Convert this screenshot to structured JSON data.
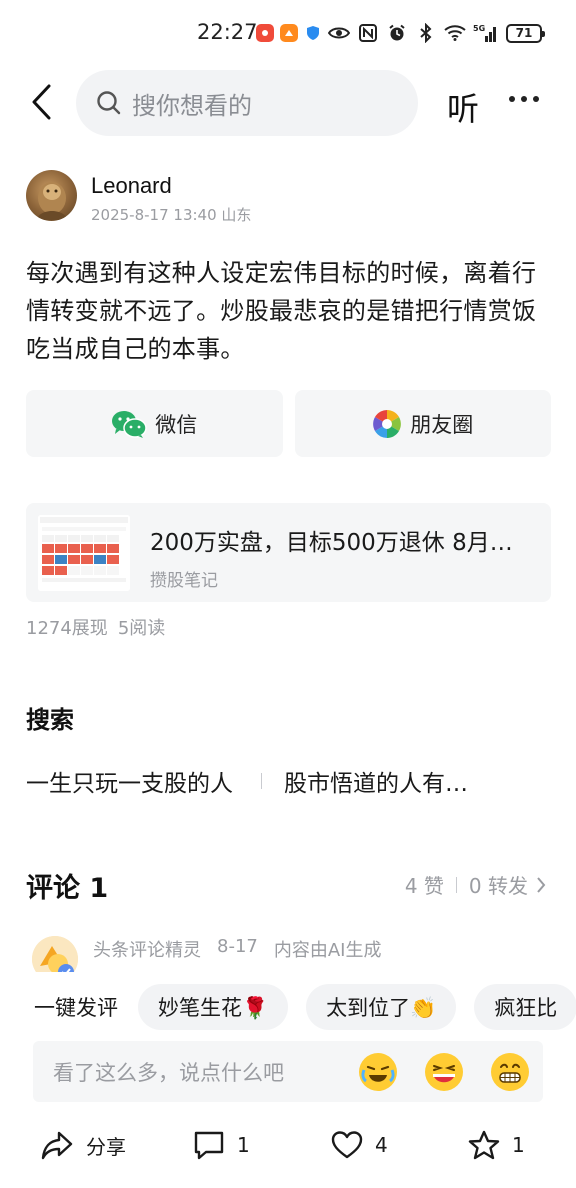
{
  "status_bar": {
    "time": "22:27",
    "battery": "71",
    "network": "5G",
    "nfc_label": "N"
  },
  "header": {
    "search_placeholder": "搜你想看的",
    "listen_label": "听"
  },
  "author": {
    "name": "Leonard",
    "datetime": "2025-8-17 13:40",
    "location": "山东"
  },
  "post": {
    "text": "每次遇到有这种人设定宏伟目标的时候，离着行情转变就不远了。炒股最悲哀的是错把行情赏饭吃当成自己的本事。"
  },
  "share": {
    "wechat_label": "微信",
    "moments_label": "朋友圈"
  },
  "linked_card": {
    "title": "200万实盘，目标500万退休 8月…",
    "source": "攒股笔记"
  },
  "stats": {
    "impressions": "1274展现",
    "reads": "5阅读"
  },
  "search_section": {
    "title": "搜索",
    "suggestions": [
      "一生只玩一支股的人",
      "股市悟道的人有…"
    ]
  },
  "comments": {
    "title": "评论 1",
    "likes": "4 赞",
    "reposts": "0 转发",
    "ai_comment": {
      "author": "头条评论精灵",
      "date": "8-17",
      "note": "内容由AI生成"
    },
    "quick_label": "一键发评",
    "quick_chips": [
      "妙笔生花🌹",
      "太到位了👏",
      "疯狂比"
    ],
    "input_placeholder": "看了这么多，说点什么吧"
  },
  "bottom_bar": {
    "share_label": "分享",
    "comment_count": "1",
    "like_count": "4",
    "favorite_count": "1"
  },
  "colors": {
    "wechat_green": "#2aae67",
    "search_bg": "#f2f3f5",
    "card_bg": "#f5f6f7",
    "muted_text": "#9a9ca1"
  }
}
